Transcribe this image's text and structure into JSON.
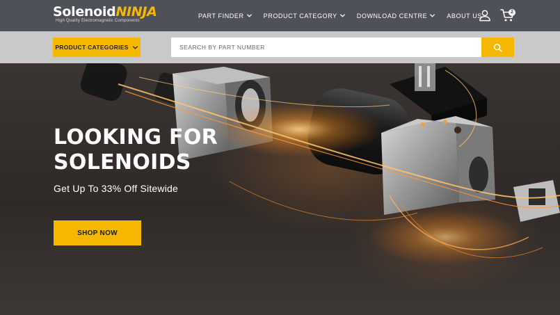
{
  "brand": {
    "name_primary": "Solenoid",
    "name_secondary": "NINJA",
    "tagline": "High Quality Electromagnetic Components"
  },
  "nav": {
    "items": [
      {
        "label": "PART FINDER"
      },
      {
        "label": "PRODUCT CATEGORY"
      },
      {
        "label": "DOWNLOAD CENTRE"
      },
      {
        "label": "ABOUT US"
      }
    ],
    "cart_count": "2",
    "icons": [
      "user-icon",
      "cart-icon",
      "chevron-down-icon"
    ]
  },
  "search": {
    "categories_label": "PRODUCT CATEGORIES",
    "placeholder": "SEARCH BY PART NUMBER",
    "icons": [
      "search-icon"
    ]
  },
  "hero": {
    "title": "LOOKING FOR SOLENOIDS",
    "subtitle": "Get Up To 33% Off Sitewide",
    "cta_label": "SHOP NOW"
  },
  "colors": {
    "accent": "#f5b700",
    "nav_bg": "#4f5159",
    "search_bg": "#c9c9c9",
    "hero_bg": "#2f2a28"
  }
}
